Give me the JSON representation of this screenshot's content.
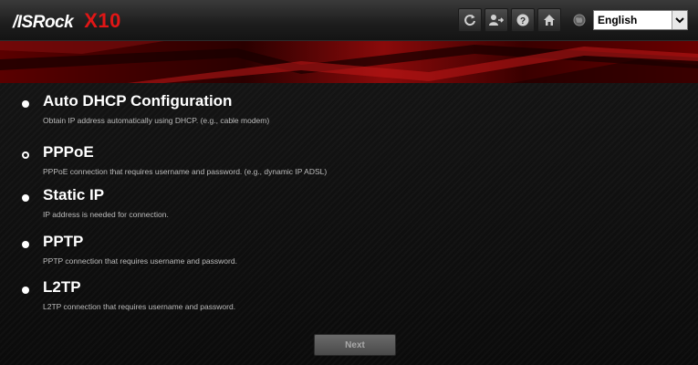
{
  "header": {
    "brand": "/ISRock",
    "model": "X10",
    "toolbar": [
      {
        "icon": "refresh-icon"
      },
      {
        "icon": "user-logout-icon"
      },
      {
        "icon": "help-icon"
      },
      {
        "icon": "home-icon"
      }
    ],
    "language": {
      "icon": "globe-icon",
      "selected": "English"
    }
  },
  "options": [
    {
      "title": "Auto DHCP Configuration",
      "description": "Obtain IP address automatically using DHCP. (e.g., cable modem)",
      "bullet": "filled"
    },
    {
      "title": "PPPoE",
      "description": "PPPoE connection that requires username and password. (e.g., dynamic IP ADSL)",
      "bullet": "hollow"
    },
    {
      "title": "Static IP",
      "description": "IP address is needed for connection.",
      "bullet": "filled"
    },
    {
      "title": "PPTP",
      "description": "PPTP connection that requires username and password.",
      "bullet": "filled"
    },
    {
      "title": "L2TP",
      "description": "L2TP connection that requires username and password.",
      "bullet": "filled"
    }
  ],
  "actions": {
    "next_label": "Next"
  },
  "colors": {
    "accent": "#e01616",
    "banner": "#7a0000"
  }
}
